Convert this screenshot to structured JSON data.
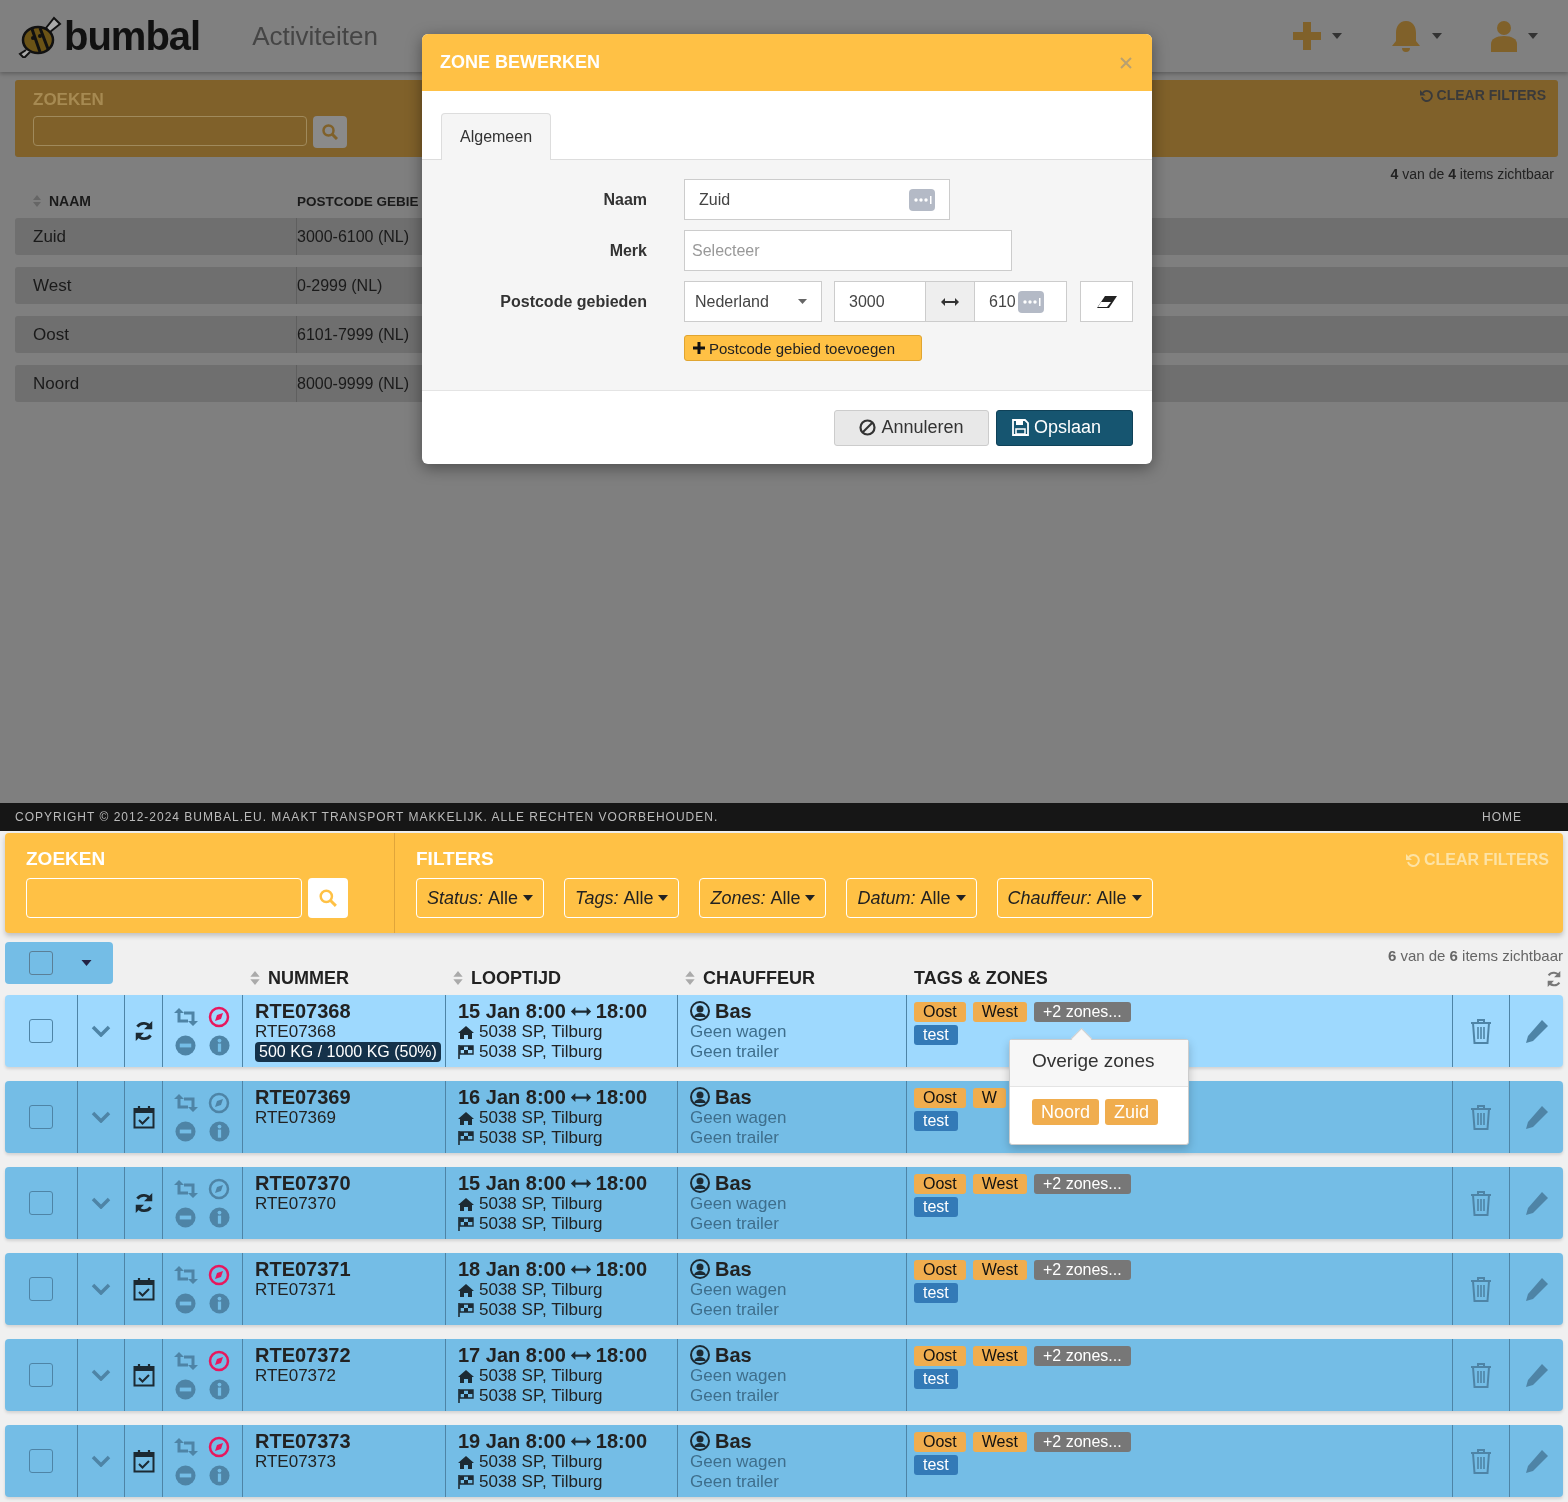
{
  "background_screen": {
    "logo": "bumbal",
    "nav": [
      {
        "label": "Activiteiten"
      }
    ],
    "search": {
      "title": "ZOEKEN"
    },
    "clear_filters": "CLEAR FILTERS",
    "count": "**4** van de **4** items zichtbaar",
    "columns": [
      "NAAM",
      "POSTCODE GEBIE"
    ],
    "rows": [
      {
        "name": "Zuid",
        "postcode": "3000-6100 (NL)"
      },
      {
        "name": "West",
        "postcode": "0-2999 (NL)"
      },
      {
        "name": "Oost",
        "postcode": "6101-7999 (NL)"
      },
      {
        "name": "Noord",
        "postcode": "8000-9999 (NL)"
      }
    ]
  },
  "modal": {
    "title": "ZONE BEWERKEN",
    "tabs": [
      {
        "label": "Algemeen",
        "selected": true
      }
    ],
    "name_label": "Naam",
    "name_value": "Zuid",
    "brand_label": "Merk",
    "brand_placeholder": "Selecteer",
    "postcode_label": "Postcode gebieden",
    "country": "Nederland",
    "postcode_from": "3000",
    "postcode_to": "610",
    "add_button": "Postcode gebied toevoegen",
    "cancel_button": "Annuleren",
    "save_button": "Opslaan"
  },
  "footer": {
    "copyright": "COPYRIGHT © 2012-2024 BUMBAL.EU. MAAKT TRANSPORT MAKKELIJK. ALLE RECHTEN VOORBEHOUDEN.",
    "link": "HOME"
  },
  "toolbar": {
    "search_title": "ZOEKEN",
    "filters_title": "FILTERS",
    "clear_filters": "CLEAR FILTERS",
    "filters": [
      {
        "label": "Status:",
        "value": "Alle"
      },
      {
        "label": "Tags:",
        "value": "Alle"
      },
      {
        "label": "Zones:",
        "value": "Alle"
      },
      {
        "label": "Datum:",
        "value": "Alle"
      },
      {
        "label": "Chauffeur:",
        "value": "Alle"
      }
    ]
  },
  "table": {
    "select_all_checked": false,
    "count": "**6** van de **6** items zichtbaar",
    "columns": [
      {
        "label": "NUMMER",
        "sortable": true
      },
      {
        "label": "LOOPTIJD",
        "sortable": true
      },
      {
        "label": "CHAUFFEUR",
        "sortable": true
      },
      {
        "label": "TAGS & ZONES",
        "sortable": false
      }
    ],
    "rows": [
      {
        "selected": true,
        "checked": false,
        "kind": "recurring",
        "navigation_active": true,
        "number": "RTE07368",
        "reference": "RTE07368",
        "load": "500 KG / 1000 KG (50%)",
        "start": "15 Jan 8:00",
        "end": "18:00",
        "from": "5038 SP, Tilburg",
        "to": "5038 SP, Tilburg",
        "driver": "Bas",
        "vehicle": "Geen wagen",
        "trailer": "Geen trailer",
        "zones": [
          "Oost",
          "West"
        ],
        "more_zones": "+2 zones...",
        "tags": [
          "test"
        ]
      },
      {
        "selected": false,
        "checked": false,
        "kind": "scheduled",
        "navigation_active": false,
        "number": "RTE07369",
        "reference": "RTE07369",
        "start": "16 Jan 8:00",
        "end": "18:00",
        "from": "5038 SP, Tilburg",
        "to": "5038 SP, Tilburg",
        "driver": "Bas",
        "vehicle": "Geen wagen",
        "trailer": "Geen trailer",
        "zones": [
          "Oost",
          "W"
        ],
        "tags": [
          "test"
        ]
      },
      {
        "selected": false,
        "checked": false,
        "kind": "recurring",
        "navigation_active": false,
        "number": "RTE07370",
        "reference": "RTE07370",
        "start": "15 Jan 8:00",
        "end": "18:00",
        "from": "5038 SP, Tilburg",
        "to": "5038 SP, Tilburg",
        "driver": "Bas",
        "vehicle": "Geen wagen",
        "trailer": "Geen trailer",
        "zones": [
          "Oost",
          "West"
        ],
        "more_zones": "+2 zones...",
        "tags": [
          "test"
        ]
      },
      {
        "selected": false,
        "checked": false,
        "kind": "scheduled",
        "navigation_active": true,
        "number": "RTE07371",
        "reference": "RTE07371",
        "start": "18 Jan 8:00",
        "end": "18:00",
        "from": "5038 SP, Tilburg",
        "to": "5038 SP, Tilburg",
        "driver": "Bas",
        "vehicle": "Geen wagen",
        "trailer": "Geen trailer",
        "zones": [
          "Oost",
          "West"
        ],
        "more_zones": "+2 zones...",
        "tags": [
          "test"
        ]
      },
      {
        "selected": false,
        "checked": false,
        "kind": "scheduled",
        "navigation_active": true,
        "number": "RTE07372",
        "reference": "RTE07372",
        "start": "17 Jan 8:00",
        "end": "18:00",
        "from": "5038 SP, Tilburg",
        "to": "5038 SP, Tilburg",
        "driver": "Bas",
        "vehicle": "Geen wagen",
        "trailer": "Geen trailer",
        "zones": [
          "Oost",
          "West"
        ],
        "more_zones": "+2 zones...",
        "tags": [
          "test"
        ]
      },
      {
        "selected": false,
        "checked": false,
        "kind": "scheduled",
        "navigation_active": true,
        "number": "RTE07373",
        "reference": "RTE07373",
        "start": "19 Jan 8:00",
        "end": "18:00",
        "from": "5038 SP, Tilburg",
        "to": "5038 SP, Tilburg",
        "driver": "Bas",
        "vehicle": "Geen wagen",
        "trailer": "Geen trailer",
        "zones": [
          "Oost",
          "West"
        ],
        "more_zones": "+2 zones...",
        "tags": [
          "test"
        ]
      }
    ]
  },
  "popover": {
    "title": "Overige zones",
    "zones": [
      "Noord",
      "Zuid"
    ]
  }
}
